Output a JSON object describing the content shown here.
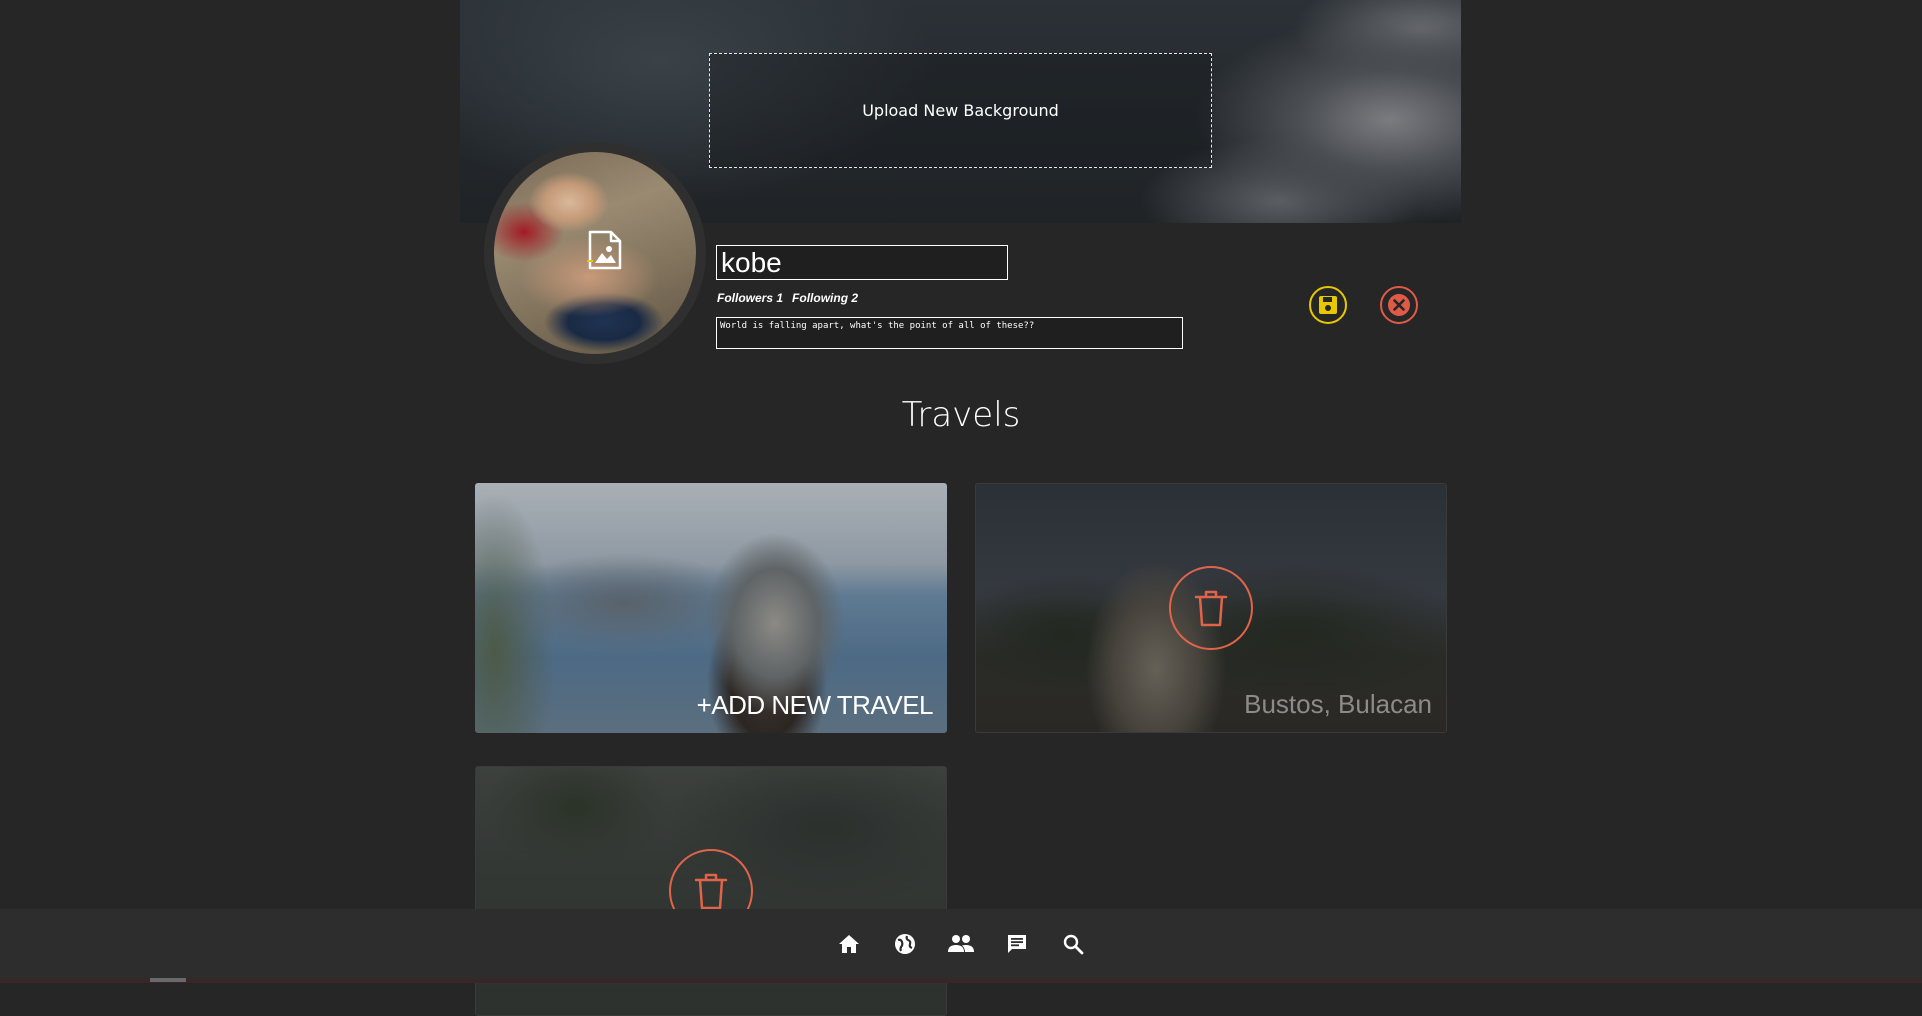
{
  "banner": {
    "upload_label": "Upload New Background"
  },
  "profile": {
    "name": "kobe",
    "followers_label": "Followers 1",
    "following_label": "Following 2",
    "bio": "World is falling apart, what's the point of all of these??"
  },
  "actions": {
    "save_icon": "save-icon",
    "cancel_icon": "close-icon"
  },
  "section": {
    "title": "Travels"
  },
  "travels": [
    {
      "label": "+ADD NEW TRAVEL",
      "type": "add"
    },
    {
      "label": "Bustos, Bulacan",
      "type": "travel"
    },
    {
      "label": "",
      "type": "travel"
    }
  ],
  "nav": {
    "items": [
      "home-icon",
      "globe-icon",
      "people-icon",
      "chat-icon",
      "search-icon"
    ]
  },
  "colors": {
    "background": "#262626",
    "save_accent": "#e6c900",
    "cancel_accent": "#e05a48",
    "delete_accent": "#e0644a"
  }
}
